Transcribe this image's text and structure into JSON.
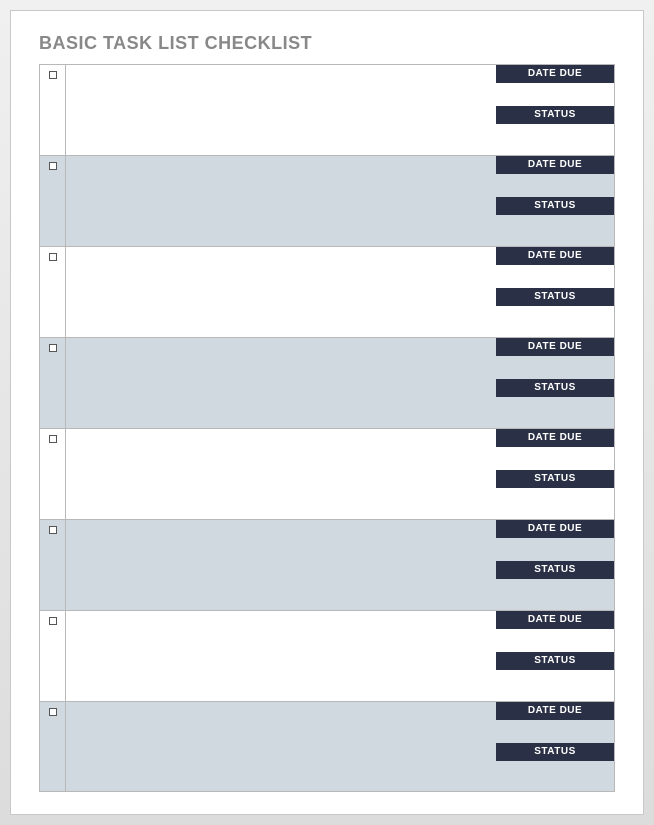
{
  "title": "BASIC TASK LIST CHECKLIST",
  "labels": {
    "date_due": "DATE DUE",
    "status": "STATUS"
  },
  "rows": [
    {
      "checked": false,
      "task": "",
      "date_due": "",
      "status": "",
      "alt": false
    },
    {
      "checked": false,
      "task": "",
      "date_due": "",
      "status": "",
      "alt": true
    },
    {
      "checked": false,
      "task": "",
      "date_due": "",
      "status": "",
      "alt": false
    },
    {
      "checked": false,
      "task": "",
      "date_due": "",
      "status": "",
      "alt": true
    },
    {
      "checked": false,
      "task": "",
      "date_due": "",
      "status": "",
      "alt": false
    },
    {
      "checked": false,
      "task": "",
      "date_due": "",
      "status": "",
      "alt": true
    },
    {
      "checked": false,
      "task": "",
      "date_due": "",
      "status": "",
      "alt": false
    },
    {
      "checked": false,
      "task": "",
      "date_due": "",
      "status": "",
      "alt": true
    }
  ]
}
